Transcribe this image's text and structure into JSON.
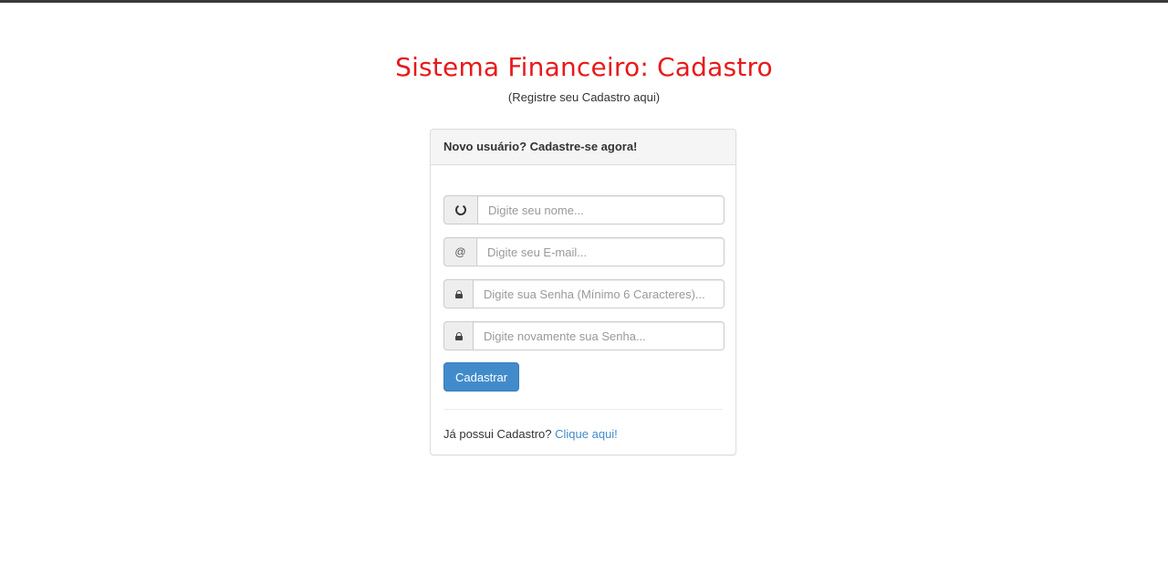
{
  "page": {
    "title": "Sistema Financeiro: Cadastro",
    "subtitle": "(Registre seu Cadastro aqui)"
  },
  "panel": {
    "heading": "Novo usuário? Cadastre-se agora!",
    "fields": {
      "name": {
        "icon": "circle-icon",
        "placeholder": "Digite seu nome..."
      },
      "email": {
        "icon": "at-icon",
        "icon_glyph": "@",
        "placeholder": "Digite seu E-mail..."
      },
      "password": {
        "icon": "lock-icon",
        "placeholder": "Digite sua Senha (Mínimo 6 Caracteres)..."
      },
      "password_confirm": {
        "icon": "lock-icon",
        "placeholder": "Digite novamente sua Senha..."
      }
    },
    "submit_label": "Cadastrar",
    "footer": {
      "prompt": "Já possui Cadastro?",
      "link_label": "Clique aqui!"
    }
  },
  "colors": {
    "title": "#e8191b",
    "primary": "#428bca",
    "link": "#428bca",
    "top_bar": "#3a3a3a"
  }
}
